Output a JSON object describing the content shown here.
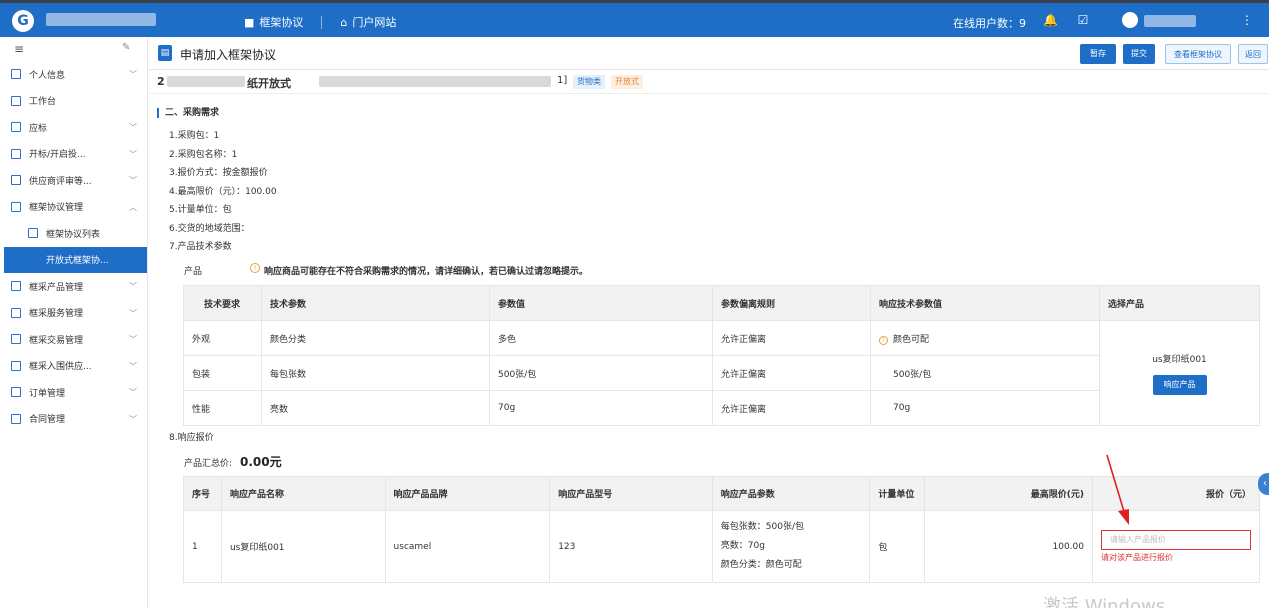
{
  "topbar": {
    "nav_items": [
      {
        "icon": "grid-icon",
        "label": "框架协议"
      },
      {
        "icon": "home-icon",
        "label": "门户网站"
      }
    ],
    "online_users_label": "在线用户数：9"
  },
  "sidebar": {
    "items": [
      {
        "label": "个人信息",
        "expandable": true
      },
      {
        "label": "工作台",
        "expandable": false
      },
      {
        "label": "应标",
        "expandable": true
      },
      {
        "label": "开标/开启投...",
        "expandable": true
      },
      {
        "label": "供应商评审等...",
        "expandable": true
      },
      {
        "label": "框架协议管理",
        "expandable": true,
        "expanded": true
      },
      {
        "label": "框架协议列表",
        "sub": true
      },
      {
        "label": "开放式框架协...",
        "sub": true,
        "active": true
      },
      {
        "label": "框采产品管理",
        "expandable": true
      },
      {
        "label": "框采服务管理",
        "expandable": true
      },
      {
        "label": "框采交易管理",
        "expandable": true
      },
      {
        "label": "框采入围供应...",
        "expandable": true
      },
      {
        "label": "订单管理",
        "expandable": true
      },
      {
        "label": "合同管理",
        "expandable": true
      }
    ]
  },
  "page": {
    "title": "申请加入框架协议",
    "buttons": {
      "save": "暂存",
      "submit": "提交",
      "view": "查看框架协议",
      "back": "返回"
    },
    "subtitle_prefix": "2",
    "subtitle_mid": "纸开放式",
    "subtitle_bracket": "1]",
    "tags": {
      "goods": "货物类",
      "open": "开放式"
    }
  },
  "section": {
    "title": "二、采购需求",
    "items": [
      "1.采购包：1",
      "2.采购包名称：1",
      "3.报价方式：按金额报价",
      "4.最高限价（元）：100.00",
      "5.计量单位：包",
      "6.交货的地域范围：",
      "7.产品技术参数"
    ],
    "product_label": "产品",
    "warning": "响应商品可能存在不符合采购需求的情况，请详细确认，若已确认过请忽略提示。"
  },
  "tech_table": {
    "headers": [
      "技术要求",
      "技术参数",
      "参数值",
      "参数偏离规则",
      "响应技术参数值",
      "选择产品"
    ],
    "rows": [
      {
        "req": "外观",
        "param": "颜色分类",
        "value": "多色",
        "rule": "允许正偏离",
        "resp": "颜色可配",
        "warn": true
      },
      {
        "req": "包装",
        "param": "每包张数",
        "value": "500张/包",
        "rule": "允许正偏离",
        "resp": "500张/包",
        "warn": false
      },
      {
        "req": "性能",
        "param": "亮数",
        "value": "70g",
        "rule": "允许正偏离",
        "resp": "70g",
        "warn": false
      }
    ],
    "selected_product": "us复印纸001",
    "respond_button": "响应产品"
  },
  "quote": {
    "title": "8.响应报价",
    "total_label": "产品汇总价:",
    "total_value": "0.00元",
    "headers": [
      "序号",
      "响应产品名称",
      "响应产品品牌",
      "响应产品型号",
      "响应产品参数",
      "计量单位",
      "最高限价(元)",
      "报价（元）"
    ],
    "row": {
      "no": "1",
      "name": "us复印纸001",
      "brand": "uscamel",
      "model": "123",
      "params": [
        "每包张数：500张/包",
        "亮数：70g",
        "颜色分类：颜色可配"
      ],
      "unit": "包",
      "max_price": "100.00",
      "input_placeholder": "请输入产品报价",
      "error": "请对该产品进行报价"
    }
  },
  "watermark": "激活 Windows",
  "colors": {
    "primary": "#1e6ec8",
    "error": "#d33333",
    "warning": "#e8a23b"
  }
}
